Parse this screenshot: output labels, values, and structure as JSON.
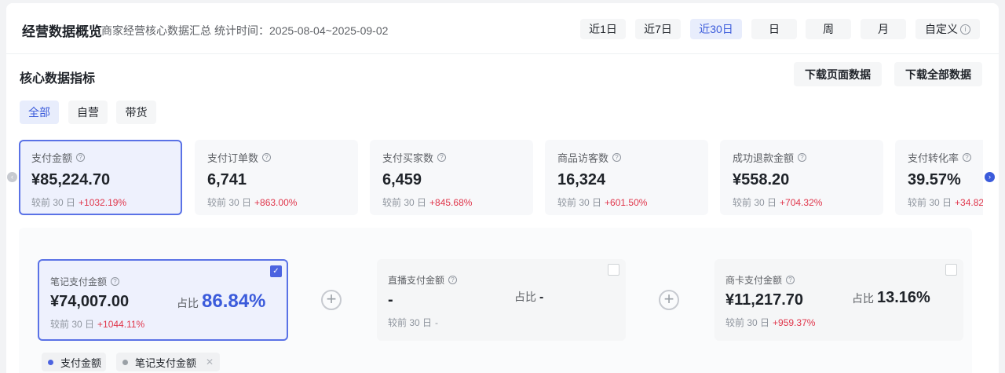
{
  "header": {
    "title": "经营数据概览",
    "subtitle": "商家经营核心数据汇总",
    "stat_time": "统计时间：2025-08-04~2025-09-02",
    "ranges": [
      {
        "label": "近1日",
        "active": false
      },
      {
        "label": "近7日",
        "active": false
      },
      {
        "label": "近30日",
        "active": true
      },
      {
        "label": "日",
        "active": false
      },
      {
        "label": "周",
        "active": false
      },
      {
        "label": "月",
        "active": false
      },
      {
        "label": "自定义",
        "active": false
      }
    ]
  },
  "core": {
    "title": "核心数据指标",
    "download_page": "下载页面数据",
    "download_all": "下载全部数据",
    "filters": [
      {
        "label": "全部",
        "active": true
      },
      {
        "label": "自营",
        "active": false
      },
      {
        "label": "带货",
        "active": false
      }
    ]
  },
  "metrics": [
    {
      "label": "支付金额",
      "value": "¥85,224.70",
      "compare_label": "较前 30 日",
      "change": "+1032.19%",
      "active": true
    },
    {
      "label": "支付订单数",
      "value": "6,741",
      "compare_label": "较前 30 日",
      "change": "+863.00%",
      "active": false
    },
    {
      "label": "支付买家数",
      "value": "6,459",
      "compare_label": "较前 30 日",
      "change": "+845.68%",
      "active": false
    },
    {
      "label": "商品访客数",
      "value": "16,324",
      "compare_label": "较前 30 日",
      "change": "+601.50%",
      "active": false
    },
    {
      "label": "成功退款金额",
      "value": "¥558.20",
      "compare_label": "较前 30 日",
      "change": "+704.32%",
      "active": false
    },
    {
      "label": "支付转化率",
      "value": "39.57%",
      "compare_label": "较前 30 日",
      "change": "+34.82",
      "active": false
    }
  ],
  "breakdown": [
    {
      "label": "笔记支付金额",
      "value": "¥74,007.00",
      "compare_label": "较前 30 日",
      "change": "+1044.11%",
      "share_label": "占比",
      "share": "86.84%",
      "checked": true
    },
    {
      "label": "直播支付金额",
      "value": "-",
      "compare_label": "较前 30 日",
      "change": "-",
      "share_label": "占比",
      "share": "-",
      "checked": false
    },
    {
      "label": "商卡支付金额",
      "value": "¥11,217.70",
      "compare_label": "较前 30 日",
      "change": "+959.37%",
      "share_label": "占比",
      "share": "13.16%",
      "checked": false
    }
  ],
  "legend": [
    {
      "label": "支付金额",
      "color": "#4c63e0"
    },
    {
      "label": "笔记支付金额",
      "color": "#9aa0a6"
    }
  ],
  "icons": {
    "info": "info-circle-icon",
    "help": "question-circle-icon",
    "plus": "plus-circle-icon",
    "check": "check-icon",
    "close": "close-icon",
    "prev": "chevron-left-icon",
    "next": "chevron-right-icon"
  }
}
